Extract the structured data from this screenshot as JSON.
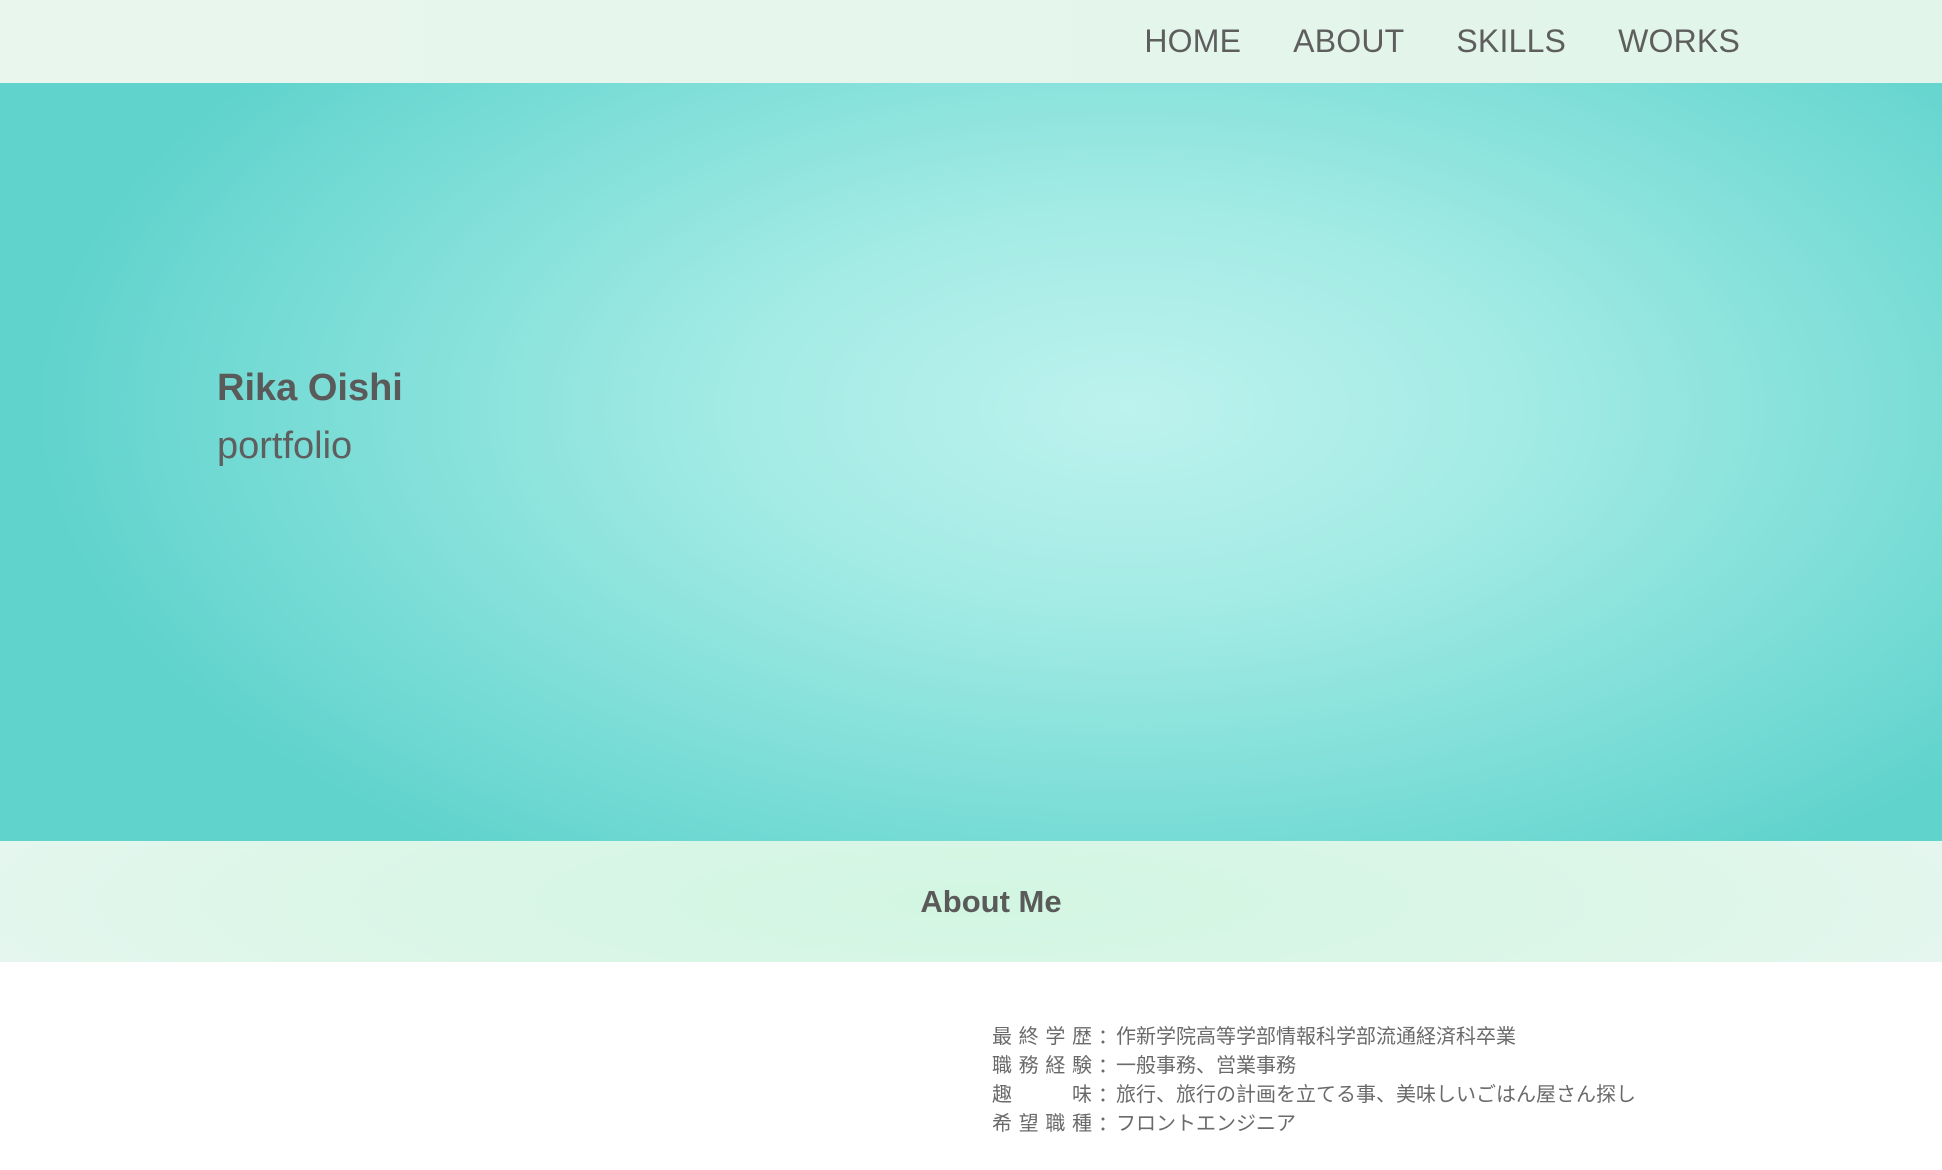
{
  "nav": {
    "items": [
      {
        "label": "HOME"
      },
      {
        "label": "ABOUT"
      },
      {
        "label": "SKILLS"
      },
      {
        "label": "WORKS"
      }
    ]
  },
  "hero": {
    "name": "Rika Oishi",
    "subtitle": "portfolio"
  },
  "about": {
    "title": "About Me",
    "rows": [
      {
        "label_chars": [
          "最",
          "終",
          "学",
          "歴"
        ],
        "colon": "：",
        "value": "作新学院高等学部情報科学部流通経済科卒業"
      },
      {
        "label_chars": [
          "職",
          "務",
          "経",
          "験"
        ],
        "colon": "：",
        "value": "一般事務、営業事務"
      },
      {
        "label_chars": [
          "趣",
          "味"
        ],
        "colon": "：",
        "value": "旅行、旅行の計画を立てる事、美味しいごはん屋さん探し"
      },
      {
        "label_chars": [
          "希",
          "望",
          "職",
          "種"
        ],
        "colon": "：",
        "value": "フロントエンジニア"
      }
    ]
  }
}
